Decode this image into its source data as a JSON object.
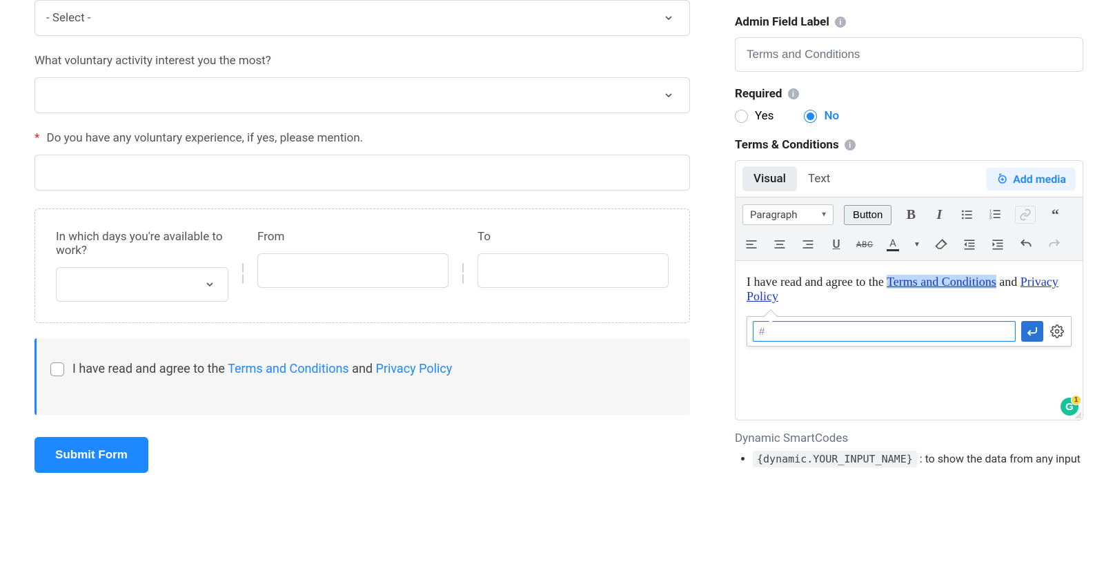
{
  "form": {
    "select1_placeholder": "- Select -",
    "activity_label": "What voluntary activity interest you the most?",
    "experience_label": "Do you have any voluntary experience, if yes, please mention.",
    "days_label": "In which days you're available to work?",
    "from_label": "From",
    "to_label": "To",
    "terms_prefix": "I have read and agree to the ",
    "terms_link1": "Terms and Conditions",
    "terms_mid": " and ",
    "terms_link2": "Privacy Policy",
    "submit_label": "Submit Form"
  },
  "side": {
    "admin_field_label": "Admin Field Label",
    "admin_field_value": "Terms and Conditions",
    "required_label": "Required",
    "required_yes": "Yes",
    "required_no": "No",
    "required_selected": "No",
    "tc_label": "Terms & Conditions",
    "tabs": {
      "visual": "Visual",
      "text": "Text"
    },
    "add_media": "Add media",
    "paragraph_select": "Paragraph",
    "button_label": "Button",
    "editor_text_pre": "I have read and agree to the ",
    "editor_link_sel": "Terms and Conditions",
    "editor_mid": " and ",
    "editor_link2": "Privacy Policy",
    "link_url_value": "#",
    "dynamic_heading": "Dynamic SmartCodes",
    "dynamic_code": "{dynamic.YOUR_INPUT_NAME}",
    "dynamic_desc_prefix": " : to show the data from any input",
    "grammarly_badge": "1"
  }
}
